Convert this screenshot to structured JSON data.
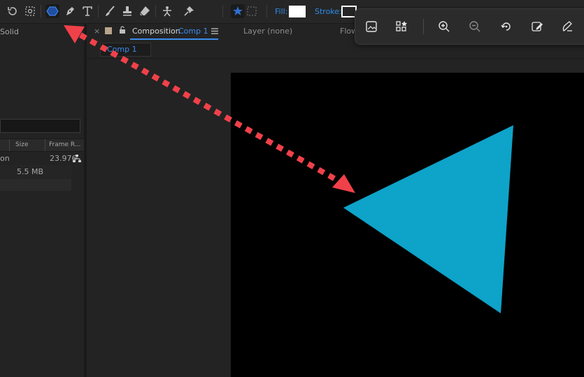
{
  "toolbar": {
    "fill_label": "Fill:",
    "stroke_label": "Stroke:",
    "fill_color": "#ffffff",
    "stroke_color": "#ffffff",
    "active_tool": "shape-tool"
  },
  "project_panel": {
    "header_label": "Solid",
    "columns": [
      "Size",
      "Frame R..."
    ],
    "rows": [
      {
        "name": "on",
        "size": "",
        "frame_rate": "23.976"
      },
      {
        "name": "",
        "size": "5.5 MB",
        "frame_rate": ""
      }
    ]
  },
  "composition_panel": {
    "close_glyph": "×",
    "tab_prefix": "Composition",
    "tab_comp_name": "Comp 1",
    "layer_tab": "Layer (none)",
    "flow_tab": "Flow",
    "breadcrumb": "Comp 1"
  },
  "canvas": {
    "background": "#000000",
    "triangle_color": "#0ea3c9"
  },
  "annotation": {
    "arrow_color": "#f0414a"
  },
  "viewer_toolbar": {
    "icons": [
      "image-icon",
      "apps-icon",
      "zoom-in-icon",
      "zoom-out-icon",
      "rotate-icon",
      "edit-image-icon",
      "draw-icon"
    ]
  }
}
